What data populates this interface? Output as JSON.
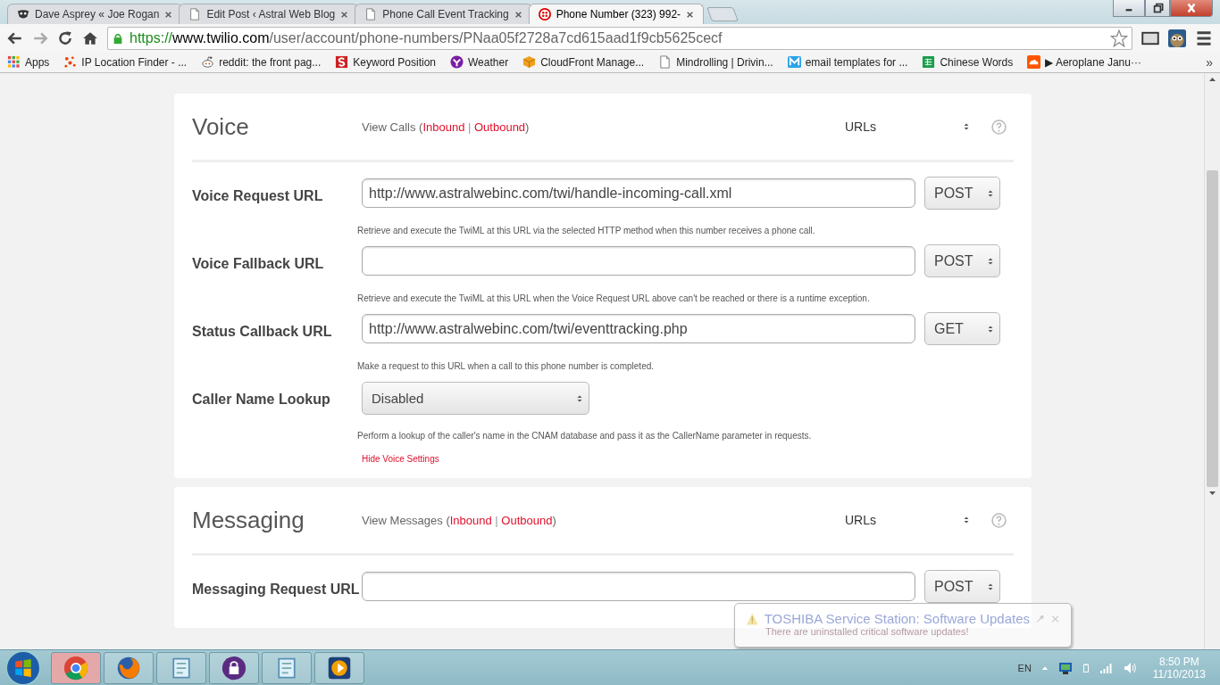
{
  "browser": {
    "tabs": [
      {
        "title": "Dave Asprey « Joe Rogan",
        "selected": false
      },
      {
        "title": "Edit Post ‹ Astral Web Blog",
        "selected": false
      },
      {
        "title": "Phone Call Event Tracking",
        "selected": false
      },
      {
        "title": "Phone Number (323) 992-",
        "selected": true
      }
    ],
    "url": {
      "scheme": "https://",
      "host": "www.twilio.com",
      "path": "/user/account/phone-numbers/PNaa05f2728a7cd615aad1f9cb5625cecf"
    },
    "bookmarks": [
      {
        "label": "Apps"
      },
      {
        "label": "IP Location Finder - ..."
      },
      {
        "label": "reddit: the front pag..."
      },
      {
        "label": "Keyword Position"
      },
      {
        "label": "Weather"
      },
      {
        "label": "CloudFront Manage..."
      },
      {
        "label": "Mindrolling | Drivin..."
      },
      {
        "label": "email templates for ..."
      },
      {
        "label": "Chinese Words"
      },
      {
        "label": "▶ Aeroplane Janu···"
      }
    ],
    "bookmarks_more": "»"
  },
  "sections": [
    {
      "title": "Voice",
      "view_label": "View Calls (",
      "links": [
        "Inbound",
        "Outbound"
      ],
      "link_separator": "|",
      "view_end": ")",
      "mode": "URLs",
      "rows": [
        {
          "kind": "url",
          "label": "Voice Request URL",
          "value": "http://www.astralwebinc.com/twi/handle-incoming-call.xml",
          "method": "POST",
          "help": "Retrieve and execute the TwiML at this URL via the selected HTTP method when this number receives a phone call."
        },
        {
          "kind": "url",
          "label": "Voice Fallback URL",
          "value": "",
          "method": "POST",
          "help": "Retrieve and execute the TwiML at this URL when the Voice Request URL above can't be reached or there is a runtime exception."
        },
        {
          "kind": "url",
          "label": "Status Callback URL",
          "value": "http://www.astralwebinc.com/twi/eventtracking.php",
          "method": "GET",
          "help": "Make a request to this URL when a call to this phone number is completed."
        },
        {
          "kind": "select",
          "label": "Caller Name Lookup",
          "value": "Disabled",
          "help": "Perform a lookup of the caller's name in the CNAM database and pass it as the CallerName parameter in requests."
        }
      ],
      "hide_link": "Hide Voice Settings"
    },
    {
      "title": "Messaging",
      "view_label": "View Messages (",
      "links": [
        "Inbound",
        "Outbound"
      ],
      "link_separator": "|",
      "view_end": ")",
      "mode": "URLs",
      "rows": [
        {
          "kind": "url",
          "label": "Messaging Request URL",
          "value": "",
          "method": "POST"
        }
      ]
    }
  ],
  "notification": {
    "title": "TOSHIBA Service Station: Software Updates",
    "message": "There are uninstalled critical software updates!"
  },
  "taskbar": {
    "apps": [
      {
        "selected": true
      },
      {
        "selected": false
      },
      {
        "selected": false
      },
      {
        "selected": false
      },
      {
        "selected": false
      },
      {
        "selected": false
      }
    ],
    "language": "EN",
    "time": "8:50 PM",
    "date": "11/10/2013"
  }
}
